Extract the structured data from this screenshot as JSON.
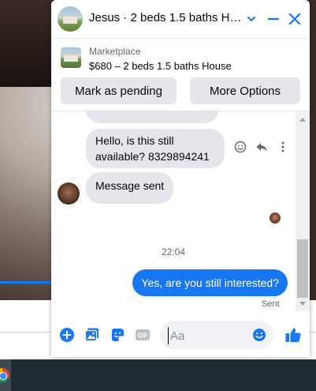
{
  "header": {
    "title": "Jesus · 2 beds 1.5 baths Ho..."
  },
  "listing": {
    "source": "Marketplace",
    "summary": "$680 – 2 beds 1.5 baths House"
  },
  "actions": {
    "mark_pending": "Mark as pending",
    "more_options": "More Options"
  },
  "messages": {
    "incoming_1": "Hello, is this still available? 8329894241",
    "incoming_2": "Message sent",
    "timestamp": "22:04",
    "outgoing_1": "Yes, are you still interested?",
    "status": "Sent"
  },
  "composer": {
    "placeholder": "Aa"
  },
  "colors": {
    "accent": "#1877f2",
    "bubble_gray": "#e4e6eb",
    "text_primary": "#050505",
    "text_secondary": "#65676b"
  },
  "icons": {
    "header": [
      "chevron-down-icon",
      "minimize-icon",
      "close-icon"
    ],
    "message_actions": [
      "smiley-icon",
      "reply-icon",
      "more-vertical-icon"
    ],
    "composer": [
      "plus-circle-icon",
      "photo-icon",
      "sticker-icon",
      "gif-icon",
      "emoji-icon",
      "thumbs-up-icon"
    ]
  }
}
